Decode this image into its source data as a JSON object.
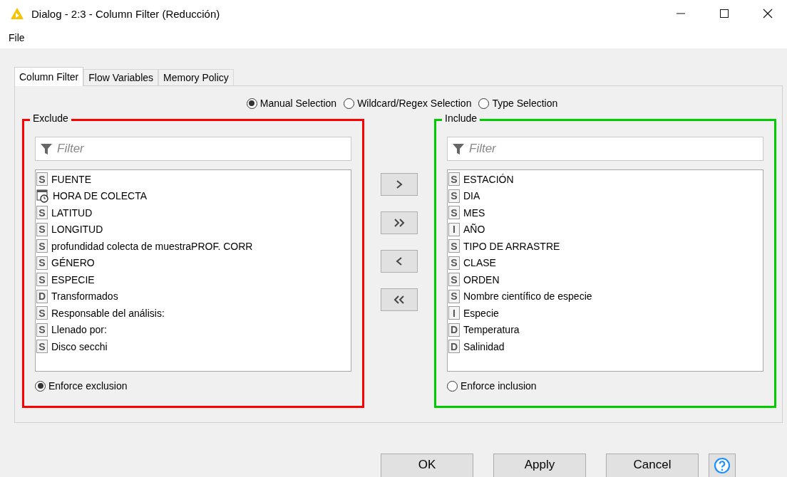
{
  "window": {
    "title": "Dialog - 2:3 - Column Filter (Reducción)"
  },
  "menu": [
    "File"
  ],
  "tabs": [
    {
      "label": "Column Filter",
      "selected": true
    },
    {
      "label": "Flow Variables",
      "selected": false
    },
    {
      "label": "Memory Policy",
      "selected": false
    }
  ],
  "modes": [
    {
      "label": "Manual Selection",
      "selected": true
    },
    {
      "label": "Wildcard/Regex Selection",
      "selected": false
    },
    {
      "label": "Type Selection",
      "selected": false
    }
  ],
  "exclude": {
    "title": "Exclude",
    "color": "#ff0000",
    "filter_placeholder": "Filter",
    "columns": [
      {
        "kind": "letter",
        "type": "S",
        "name": "FUENTE"
      },
      {
        "kind": "datetime",
        "name": "HORA DE COLECTA"
      },
      {
        "kind": "letter",
        "type": "S",
        "name": "LATITUD"
      },
      {
        "kind": "letter",
        "type": "S",
        "name": "LONGITUD"
      },
      {
        "kind": "letter",
        "type": "S",
        "name": "profundidad colecta de muestraPROF. CORR"
      },
      {
        "kind": "letter",
        "type": "S",
        "name": "GÉNERO"
      },
      {
        "kind": "letter",
        "type": "S",
        "name": "ESPECIE"
      },
      {
        "kind": "letter",
        "type": "D",
        "name": "Transformados"
      },
      {
        "kind": "letter",
        "type": "S",
        "name": "Responsable del análisis:"
      },
      {
        "kind": "letter",
        "type": "S",
        "name": "Llenado por:"
      },
      {
        "kind": "letter",
        "type": "S",
        "name": "Disco secchi"
      }
    ],
    "enforce": {
      "label": "Enforce exclusion",
      "selected": true
    }
  },
  "include": {
    "title": "Include",
    "color": "#00cc00",
    "filter_placeholder": "Filter",
    "columns": [
      {
        "kind": "letter",
        "type": "S",
        "name": "ESTACIÓN"
      },
      {
        "kind": "letter",
        "type": "S",
        "name": "DIA"
      },
      {
        "kind": "letter",
        "type": "S",
        "name": "MES"
      },
      {
        "kind": "letter",
        "type": "I",
        "name": "AÑO"
      },
      {
        "kind": "letter",
        "type": "S",
        "name": "TIPO DE ARRASTRE"
      },
      {
        "kind": "letter",
        "type": "S",
        "name": "CLASE"
      },
      {
        "kind": "letter",
        "type": "S",
        "name": "ORDEN"
      },
      {
        "kind": "letter",
        "type": "S",
        "name": "Nombre científico de especie"
      },
      {
        "kind": "letter",
        "type": "I",
        "name": "Especie"
      },
      {
        "kind": "letter",
        "type": "D",
        "name": "Temperatura"
      },
      {
        "kind": "letter",
        "type": "D",
        "name": "Salinidad"
      }
    ],
    "enforce": {
      "label": "Enforce inclusion",
      "selected": false
    }
  },
  "buttons": [
    "OK",
    "Apply",
    "Cancel"
  ]
}
